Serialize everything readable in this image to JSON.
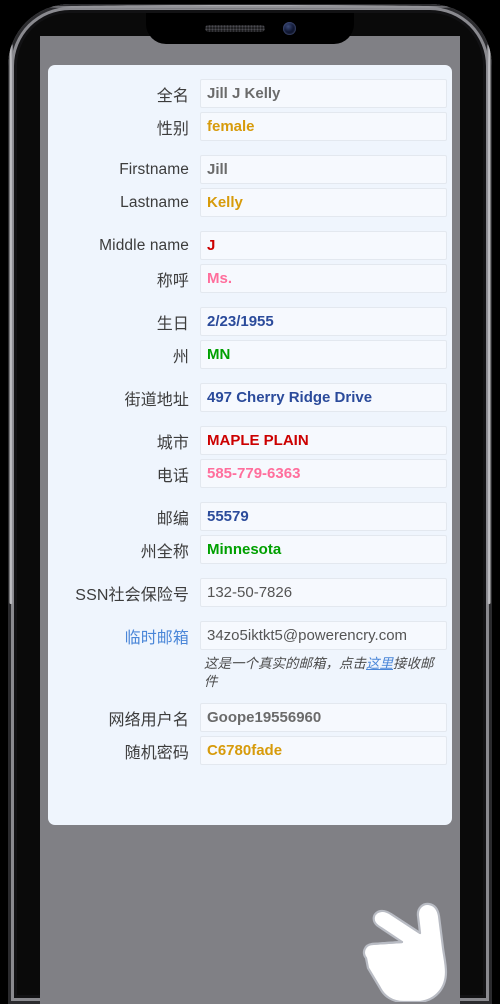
{
  "device": {
    "notch": {
      "speaker_icon": "speaker-grille-icon",
      "camera_icon": "front-camera-icon"
    }
  },
  "form": {
    "fields": [
      {
        "label": "全名",
        "value": "Jill J Kelly",
        "value_color": "#6b6b6b",
        "style": "v-gray",
        "name": "full-name",
        "group_start": false
      },
      {
        "label": "性别",
        "value": "female",
        "value_color": "#d79b0b",
        "style": "v-orange",
        "name": "gender",
        "group_start": false
      },
      {
        "label": "Firstname",
        "value": "Jill",
        "value_color": "#6b6b6b",
        "style": "v-gray",
        "name": "firstname",
        "group_start": true
      },
      {
        "label": "Lastname",
        "value": "Kelly",
        "value_color": "#d79b0b",
        "style": "v-orange",
        "name": "lastname",
        "group_start": false
      },
      {
        "label": "Middle name",
        "value": "J",
        "value_color": "#cc0000",
        "style": "v-red",
        "name": "middle-name",
        "group_start": true
      },
      {
        "label": "称呼",
        "value": "Ms.",
        "value_color": "#ff6e9c",
        "style": "v-pink",
        "name": "title",
        "group_start": false
      },
      {
        "label": "生日",
        "value": "2/23/1955",
        "value_color": "#2b4b9b",
        "style": "v-navy",
        "name": "birthday",
        "group_start": true
      },
      {
        "label": "州",
        "value": "MN",
        "value_color": "#00a000",
        "style": "v-green",
        "name": "state-abbr",
        "group_start": false
      },
      {
        "label": "街道地址",
        "value": "497 Cherry Ridge Drive",
        "value_color": "#2b4b9b",
        "style": "v-navy",
        "name": "street-address",
        "group_start": true
      },
      {
        "label": "城市",
        "value": "MAPLE PLAIN",
        "value_color": "#cc0000",
        "style": "v-red",
        "name": "city",
        "group_start": true
      },
      {
        "label": "电话",
        "value": "585-779-6363",
        "value_color": "#ff6e9c",
        "style": "v-pink",
        "name": "phone",
        "group_start": false
      },
      {
        "label": "邮编",
        "value": "55579",
        "value_color": "#2b4b9b",
        "style": "v-navy",
        "name": "zipcode",
        "group_start": true
      },
      {
        "label": "州全称",
        "value": "Minnesota",
        "value_color": "#00a000",
        "style": "v-green",
        "name": "state-full",
        "group_start": false
      },
      {
        "label": "SSN社会保险号",
        "value": "132-50-7826",
        "value_color": "#555555",
        "style": "v-plain",
        "name": "ssn",
        "group_start": true
      }
    ],
    "email_field": {
      "label": "临时邮箱",
      "label_color": "#4a86d8",
      "value": "34zo5iktkt5@powerencry.com",
      "name": "temp-email"
    },
    "email_hint": {
      "prefix": "这是一个真实的邮箱，点击",
      "link": "这里",
      "suffix": "接收邮件"
    },
    "bottom_fields": [
      {
        "label": "网络用户名",
        "value": "Goope19556960",
        "value_color": "#6b6b6b",
        "style": "v-gray",
        "name": "web-username"
      },
      {
        "label": "随机密码",
        "value": "C6780fade",
        "value_color": "#d79b0b",
        "style": "v-orange",
        "name": "random-password"
      }
    ]
  },
  "cursor": {
    "icon": "pointing-hand-cursor"
  }
}
